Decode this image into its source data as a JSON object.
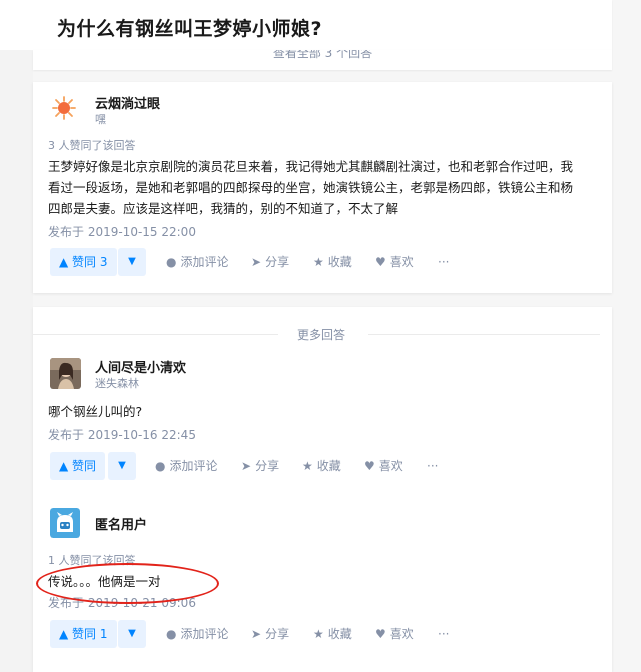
{
  "question": {
    "title": "为什么有钢丝叫王梦婷小师娘?"
  },
  "top_card": {
    "view_all": "查看全部 3 个回答"
  },
  "answers": [
    {
      "author_name": "云烟淌过眼",
      "author_bio": "嘿",
      "votes_meta": "3 人赞同了该回答",
      "content_lines": [
        "王梦婷好像是北京京剧院的演员花旦来着，我记得她尤其麒麟剧社演过，也和老郭合作过吧，我",
        "看过一段返场，是她和老郭唱的四郎探母的坐宫，她演铁镜公主，老郭是杨四郎，铁镜公主和杨",
        "四郎是夫妻。应该是这样吧，我猜的，别的不知道了，不太了解"
      ],
      "date": "发布于 2019-10-15 22:00",
      "upvote": "▲ 赞同 3"
    },
    {
      "author_name": "人间尽是小清欢",
      "author_bio": "迷失森林",
      "votes_meta": "",
      "content_lines": [
        "哪个钢丝儿叫的?"
      ],
      "date": "发布于 2019-10-16 22:45",
      "upvote": "▲ 赞同"
    },
    {
      "author_name": "匿名用户",
      "author_bio": "",
      "votes_meta": "1 人赞同了该回答",
      "content_lines": [
        "传说。。。他俩是一对"
      ],
      "date": "发布于 2019-10-21 09:06",
      "upvote": "▲ 赞同 1"
    }
  ],
  "more_answers_label": "更多回答",
  "actions": {
    "downvote": "▼",
    "comment": "添加评论",
    "share": "分享",
    "favorite": "收藏",
    "like": "喜欢",
    "more": "···"
  },
  "icons": {
    "comment": "comment-icon",
    "share": "share-icon",
    "favorite": "star-icon",
    "like": "heart-icon",
    "more": "more-icon"
  },
  "colors": {
    "accent": "#0084ff",
    "accent_bg": "#e8f2ff",
    "annotation": "#e2231a",
    "meta": "#8590a6"
  }
}
